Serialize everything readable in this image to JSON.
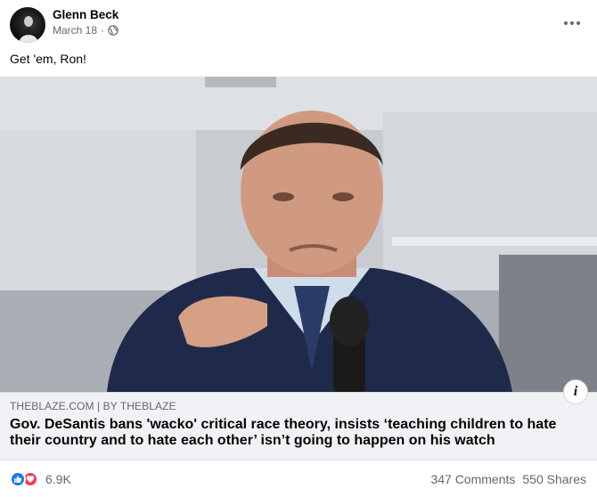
{
  "post": {
    "author": "Glenn Beck",
    "date": "March 18",
    "separator": "·",
    "audience_icon": "globe-icon",
    "more_icon": "more-options-icon",
    "text": "Get 'em, Ron!"
  },
  "link_preview": {
    "domain": "THEBLAZE.COM | BY THEBLAZE",
    "title": "Gov. DeSantis bans 'wacko' critical race theory, insists ‘teaching children to hate their country and to hate each other’ isn’t going to happen on his watch",
    "info_icon": "info-icon",
    "info_label": "i"
  },
  "engagement": {
    "reaction_icons": [
      "like-icon",
      "love-icon"
    ],
    "reaction_count": "6.9K",
    "comments": "347 Comments",
    "shares": "550 Shares"
  },
  "colors": {
    "like": "#1877f2",
    "love": "#f33e58",
    "secondary_text": "#65676b",
    "card_background": "#f0f2f5"
  }
}
